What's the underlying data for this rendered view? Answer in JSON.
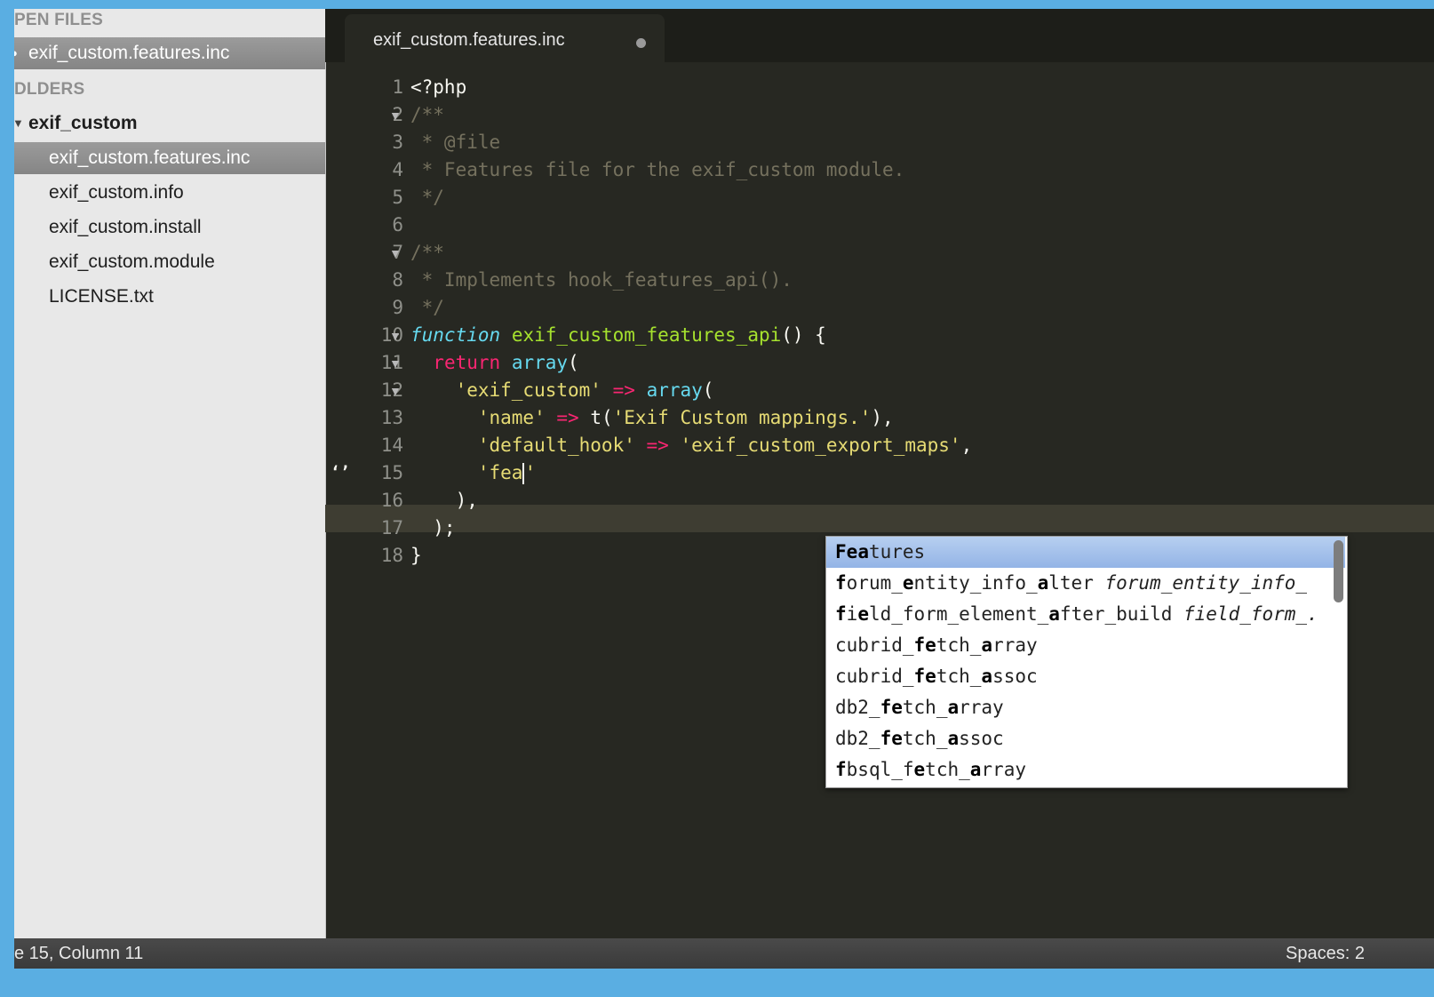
{
  "sidebar": {
    "open_files_header": "PEN FILES",
    "open_file": "exif_custom.features.inc",
    "folders_header": "DLDERS",
    "folder_name": "exif_custom",
    "files": [
      "exif_custom.features.inc",
      "exif_custom.info",
      "exif_custom.install",
      "exif_custom.module",
      "LICENSE.txt"
    ]
  },
  "tab": {
    "title": "exif_custom.features.inc",
    "modified_indicator": "dirty-dot-icon"
  },
  "editor": {
    "line_numbers": [
      "1",
      "2",
      "3",
      "4",
      "5",
      "6",
      "7",
      "8",
      "9",
      "10",
      "11",
      "12",
      "13",
      "14",
      "15",
      "16",
      "17",
      "18"
    ],
    "bookmark_marker": "‘’",
    "current_line": 15
  },
  "autocomplete": {
    "items": [
      "Features",
      "forum_entity_info_alter forum_entity_info_",
      "field_form_element_after_build field_form_.",
      "cubrid_fetch_array",
      "cubrid_fetch_assoc",
      "db2_fetch_array",
      "db2_fetch_assoc",
      "fbsql_fetch_array"
    ],
    "selected_index": 0
  },
  "status": {
    "position": "e 15, Column 11",
    "indentation": "Spaces: 2"
  },
  "colors": {
    "editor_bg": "#272822",
    "sidebar_bg": "#e8e8e8",
    "accent_frame": "#5aaee2"
  }
}
